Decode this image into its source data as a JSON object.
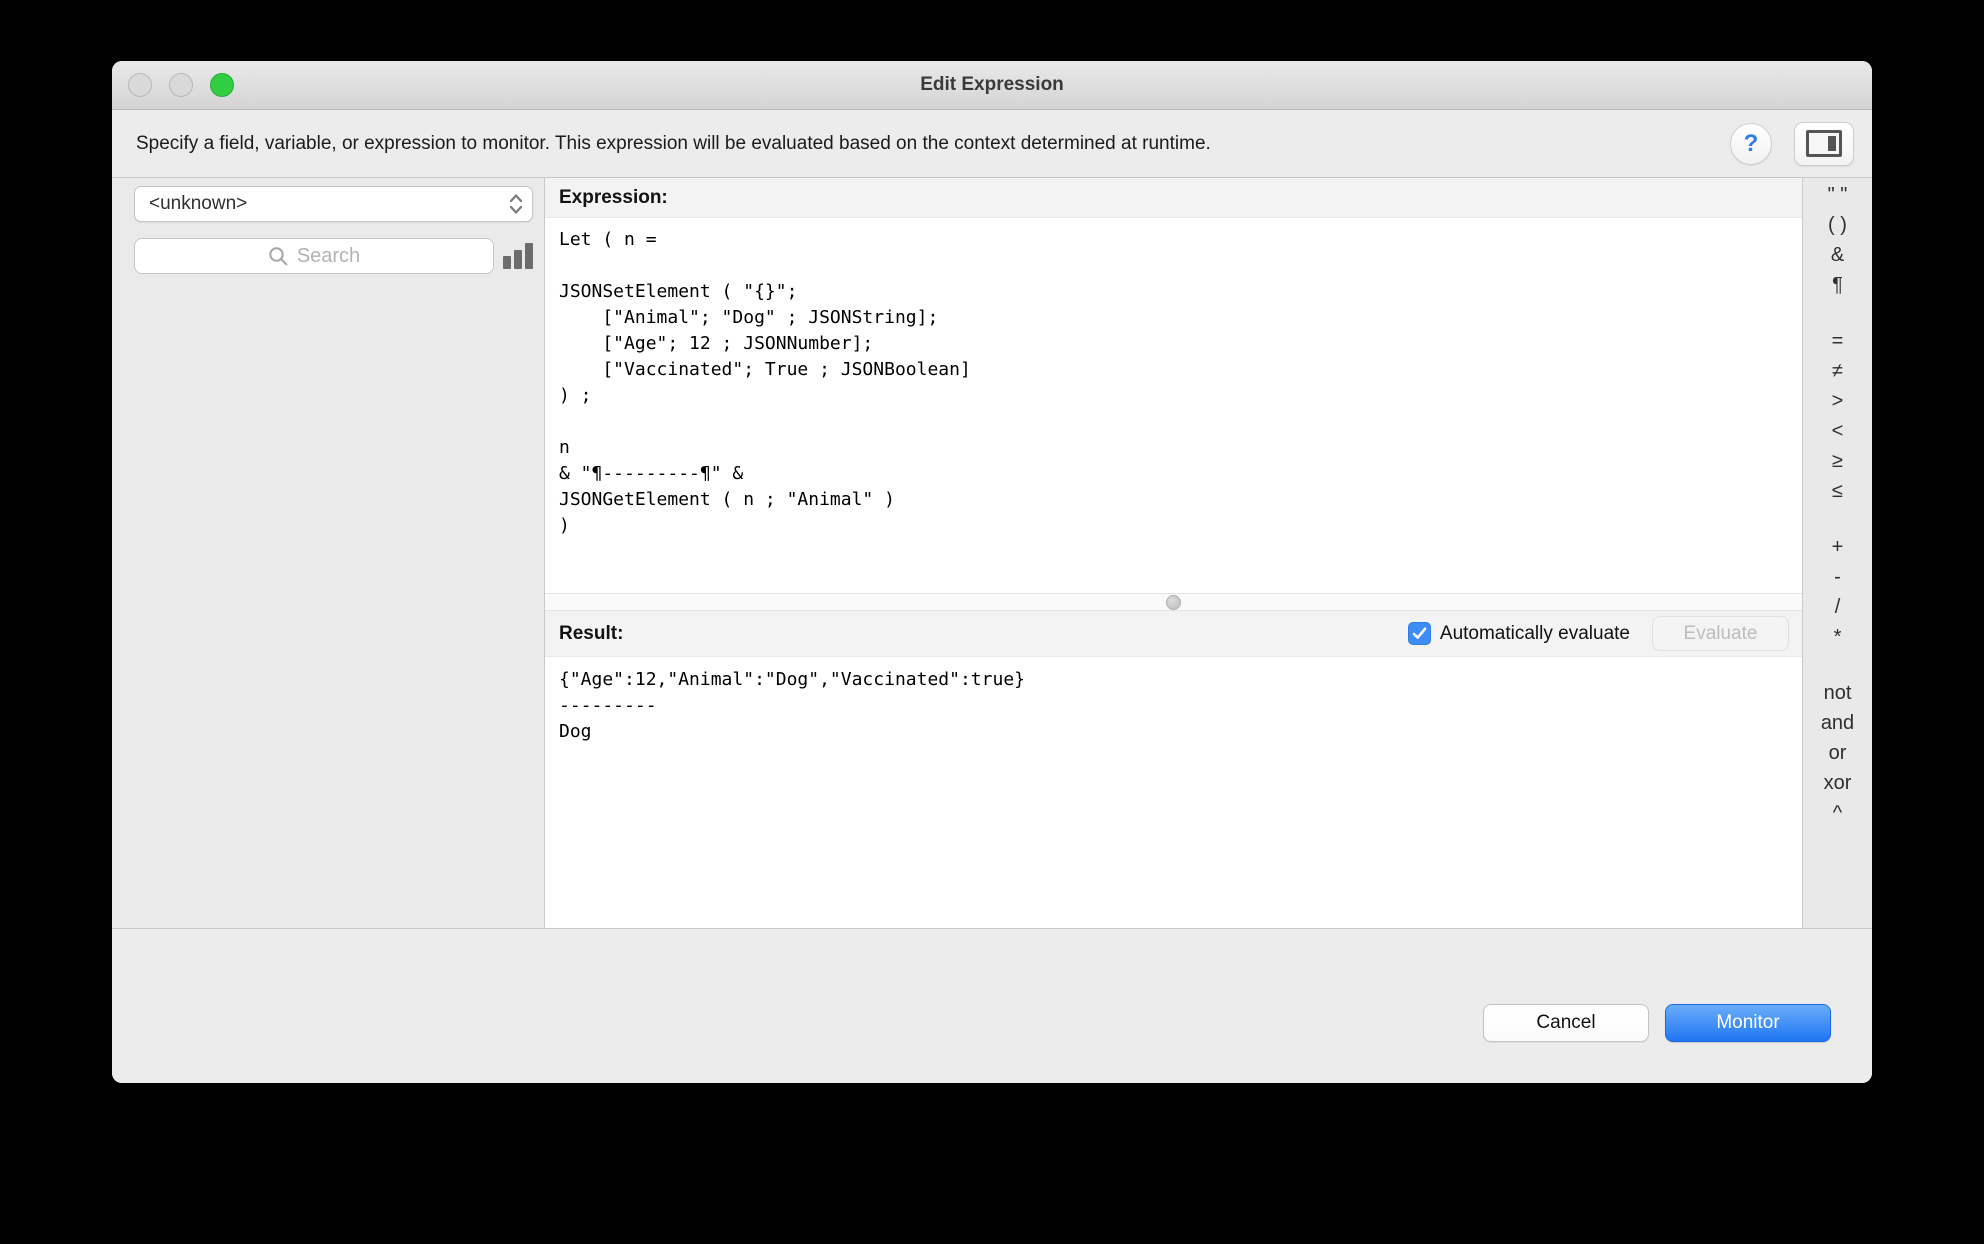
{
  "window": {
    "title": "Edit Expression"
  },
  "banner": {
    "text": "Specify a field, variable, or expression to monitor. This expression will be evaluated based on the context determined at runtime.",
    "help_label": "?"
  },
  "sidebar": {
    "context_value": "<unknown>",
    "search_placeholder": "Search"
  },
  "expression": {
    "label": "Expression:",
    "code": "Let ( n = \n\nJSONSetElement ( \"{}\";\n    [\"Animal\"; \"Dog\" ; JSONString];\n    [\"Age\"; 12 ; JSONNumber];\n    [\"Vaccinated\"; True ; JSONBoolean]\n) ;\n\nn \n& \"¶---------¶\" &\nJSONGetElement ( n ; \"Animal\" )\n)"
  },
  "result": {
    "label": "Result:",
    "auto_evaluate_label": "Automatically evaluate",
    "auto_evaluate_checked": true,
    "evaluate_label": "Evaluate",
    "text": "{\"Age\":12,\"Animal\":\"Dog\",\"Vaccinated\":true}\n---------\nDog"
  },
  "operators": {
    "groups": [
      {
        "items": [
          "\" \"",
          "( )",
          "&",
          "¶"
        ]
      },
      {
        "items": [
          "=",
          "≠",
          ">",
          "<",
          "≥",
          "≤"
        ]
      },
      {
        "items": [
          "+",
          "-",
          "/",
          "*"
        ]
      },
      {
        "items": [
          "not",
          "and",
          "or",
          "xor",
          "^"
        ]
      }
    ]
  },
  "footer": {
    "cancel_label": "Cancel",
    "monitor_label": "Monitor"
  },
  "icons": {
    "traffic_lights": "window-controls",
    "help": "question-mark-circle",
    "panel_toggle": "right-sidebar-toggle",
    "dropdown_stepper": "up-down-chevrons",
    "search": "magnifier",
    "search_results": "bar-chart",
    "splitter_handle": "drag-dot",
    "checkbox_check": "checkmark"
  },
  "colors": {
    "accent_blue": "#2d7bf5",
    "checkbox_blue": "#3d8df5",
    "monitor_gradient_top": "#6aadf9",
    "monitor_gradient_bottom": "#1f76f4",
    "green_light": "#31ce41",
    "panel_gray": "#eaeaea"
  }
}
